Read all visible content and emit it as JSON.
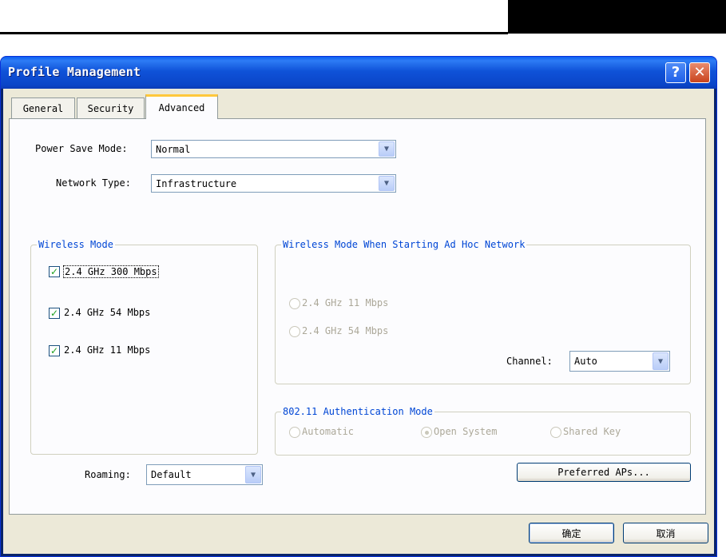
{
  "window": {
    "title": "Profile Management",
    "help_glyph": "?",
    "close_glyph": "✕"
  },
  "tabs": [
    "General",
    "Security",
    "Advanced"
  ],
  "active_tab": "Advanced",
  "power_save": {
    "label": "Power Save Mode:",
    "value": "Normal"
  },
  "network_type": {
    "label": "Network Type:",
    "value": "Infrastructure"
  },
  "wireless_mode": {
    "legend": "Wireless Mode",
    "options": [
      {
        "label": "2.4 GHz 300 Mbps",
        "checked": true
      },
      {
        "label": "2.4 GHz 54 Mbps",
        "checked": true
      },
      {
        "label": "2.4 GHz 11 Mbps",
        "checked": true
      }
    ]
  },
  "roaming": {
    "label": "Roaming:",
    "value": "Default"
  },
  "adhoc_mode": {
    "legend": "Wireless Mode When Starting Ad Hoc Network",
    "options": [
      "2.4 GHz 11 Mbps",
      "2.4 GHz 54 Mbps"
    ],
    "channel_label": "Channel:",
    "channel_value": "Auto"
  },
  "auth_mode": {
    "legend": "802.11 Authentication Mode",
    "options": [
      "Automatic",
      "Open System",
      "Shared Key"
    ],
    "selected": "Open System"
  },
  "preferred_aps_label": "Preferred APs...",
  "ok_label": "确定",
  "cancel_label": "取消",
  "check_glyph": "✓",
  "dropdown_glyph": "▼"
}
